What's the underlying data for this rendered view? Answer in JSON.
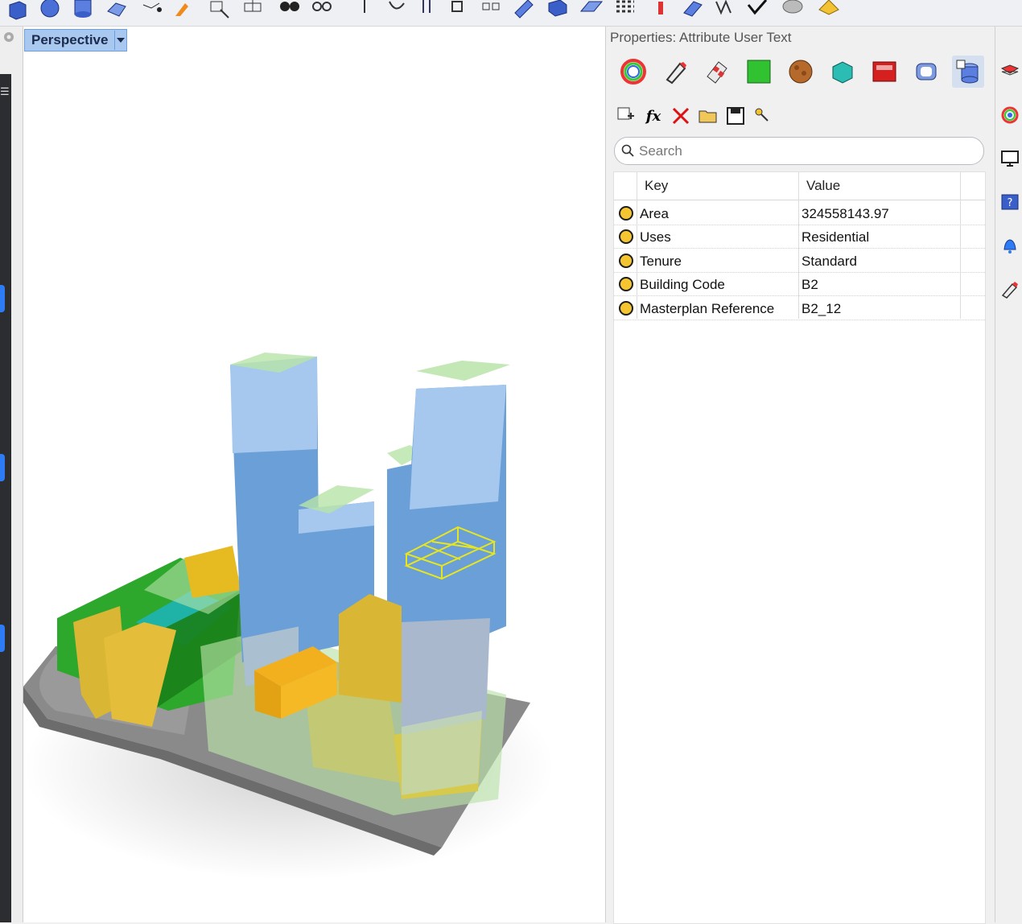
{
  "viewport": {
    "tab_label": "Perspective"
  },
  "properties": {
    "title": "Properties: Attribute User Text",
    "page_icons": [
      "object-color-wheel-icon",
      "material-brush-icon",
      "texture-mapping-icon",
      "surface-green-icon",
      "decal-sphere-icon",
      "round-edge-icon",
      "section-box-icon",
      "shell-icon",
      "user-text-cylinder-icon"
    ],
    "active_page": "user-text-cylinder-icon",
    "tools": [
      "add-key-icon",
      "formula-fx-icon",
      "delete-x-icon",
      "open-folder-icon",
      "save-disk-icon",
      "link-key-icon"
    ],
    "search": {
      "placeholder": "Search",
      "value": ""
    },
    "table": {
      "headers": {
        "key": "Key",
        "value": "Value"
      },
      "rows": [
        {
          "key": "Area",
          "value": "324558143.97"
        },
        {
          "key": "Uses",
          "value": "Residential"
        },
        {
          "key": "Tenure",
          "value": "Standard"
        },
        {
          "key": "Building Code",
          "value": "B2"
        },
        {
          "key": "Masterplan Reference",
          "value": "B2_12"
        }
      ]
    }
  },
  "right_sidebar": [
    "layers-icon",
    "color-wheel-icon",
    "display-monitor-icon",
    "help-icon",
    "notifications-bell-icon",
    "rendering-brush-icon"
  ],
  "colors": {
    "accent_tab": "#a9c8f0",
    "row_dot": "#f5c431",
    "tower_blue": "#6b9fd8",
    "selection_yellow": "#e6e61e"
  }
}
